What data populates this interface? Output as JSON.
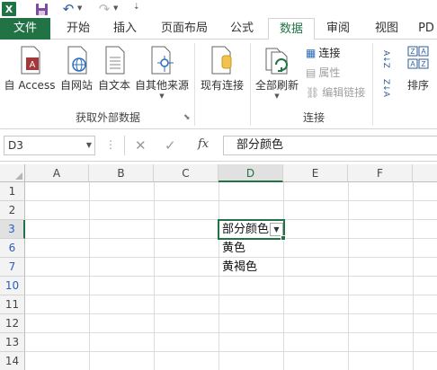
{
  "qat": {
    "logo": "X",
    "save_icon": "save-icon",
    "undo_icon": "undo-icon",
    "redo_icon": "redo-icon"
  },
  "tabs": [
    {
      "label": "文件"
    },
    {
      "label": "开始"
    },
    {
      "label": "插入"
    },
    {
      "label": "页面布局"
    },
    {
      "label": "公式"
    },
    {
      "label": "数据"
    },
    {
      "label": "审阅"
    },
    {
      "label": "视图"
    },
    {
      "label": "PD"
    }
  ],
  "ribbon": {
    "external": {
      "access": "自 Access",
      "web": "自网站",
      "text": "自文本",
      "other": "自其他来源",
      "group_label": "获取外部数据"
    },
    "existing": "现有连接",
    "connections": {
      "refresh_all": "全部刷新",
      "connections": "连接",
      "properties": "属性",
      "edit_links": "编辑链接",
      "group_label": "连接"
    },
    "sort": {
      "sort_az": "A↓Z",
      "sort_za": "Z↓A",
      "sort_label": "排序"
    }
  },
  "formula_bar": {
    "name_box": "D3",
    "fx": "fx",
    "formula": "部分颜色"
  },
  "columns": [
    "A",
    "B",
    "C",
    "D",
    "E",
    "F"
  ],
  "rows": [
    "1",
    "2",
    "3",
    "6",
    "7",
    "10",
    "11",
    "12",
    "13",
    "14"
  ],
  "cells": {
    "d3": "部分颜色",
    "d6": "黄色",
    "d7": "黄褐色"
  },
  "colors": {
    "accent": "#217346",
    "filtered_row": "#2a5cbf"
  }
}
